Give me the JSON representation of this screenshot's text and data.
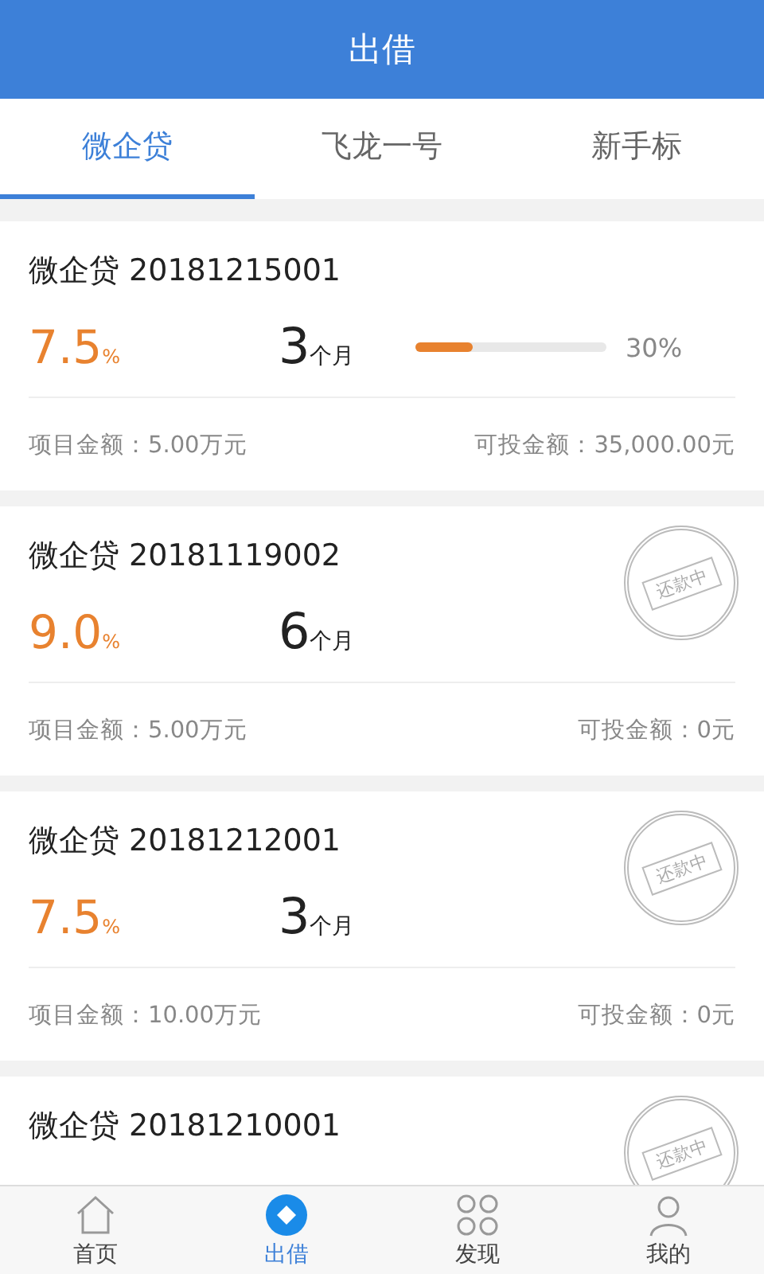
{
  "header": {
    "title": "出借"
  },
  "tabs": [
    {
      "label": "微企贷",
      "selected": true
    },
    {
      "label": "飞龙一号",
      "selected": false
    },
    {
      "label": "新手标",
      "selected": false
    }
  ],
  "loans": [
    {
      "title": "微企贷 20181215001",
      "rate": "7.5",
      "rate_unit": "%",
      "term": "3",
      "term_unit": "个月",
      "status": {
        "kind": "progress",
        "level": 0.3,
        "reading": "30%"
      },
      "amount": "项目金额：5.00万元",
      "available": "可投金额：35,000.00元"
    },
    {
      "title": "微企贷 20181119002",
      "rate": "9.0",
      "rate_unit": "%",
      "term": "6",
      "term_unit": "个月",
      "status": {
        "kind": "stamp",
        "text": "还款中"
      },
      "amount": "项目金额：5.00万元",
      "available": "可投金额：0元"
    },
    {
      "title": "微企贷 20181212001",
      "rate": "7.5",
      "rate_unit": "%",
      "term": "3",
      "term_unit": "个月",
      "status": {
        "kind": "stamp",
        "text": "还款中"
      },
      "amount": "项目金额：10.00万元",
      "available": "可投金额：0元"
    },
    {
      "title": "微企贷 20181210001",
      "status": {
        "kind": "stamp",
        "text": "还款中"
      }
    }
  ],
  "nav": [
    {
      "label": "首页",
      "kind": "home",
      "selected": false
    },
    {
      "label": "出借",
      "kind": "lend",
      "selected": true
    },
    {
      "label": "发现",
      "kind": "grid",
      "selected": false
    },
    {
      "label": "我的",
      "kind": "user",
      "selected": false
    }
  ]
}
